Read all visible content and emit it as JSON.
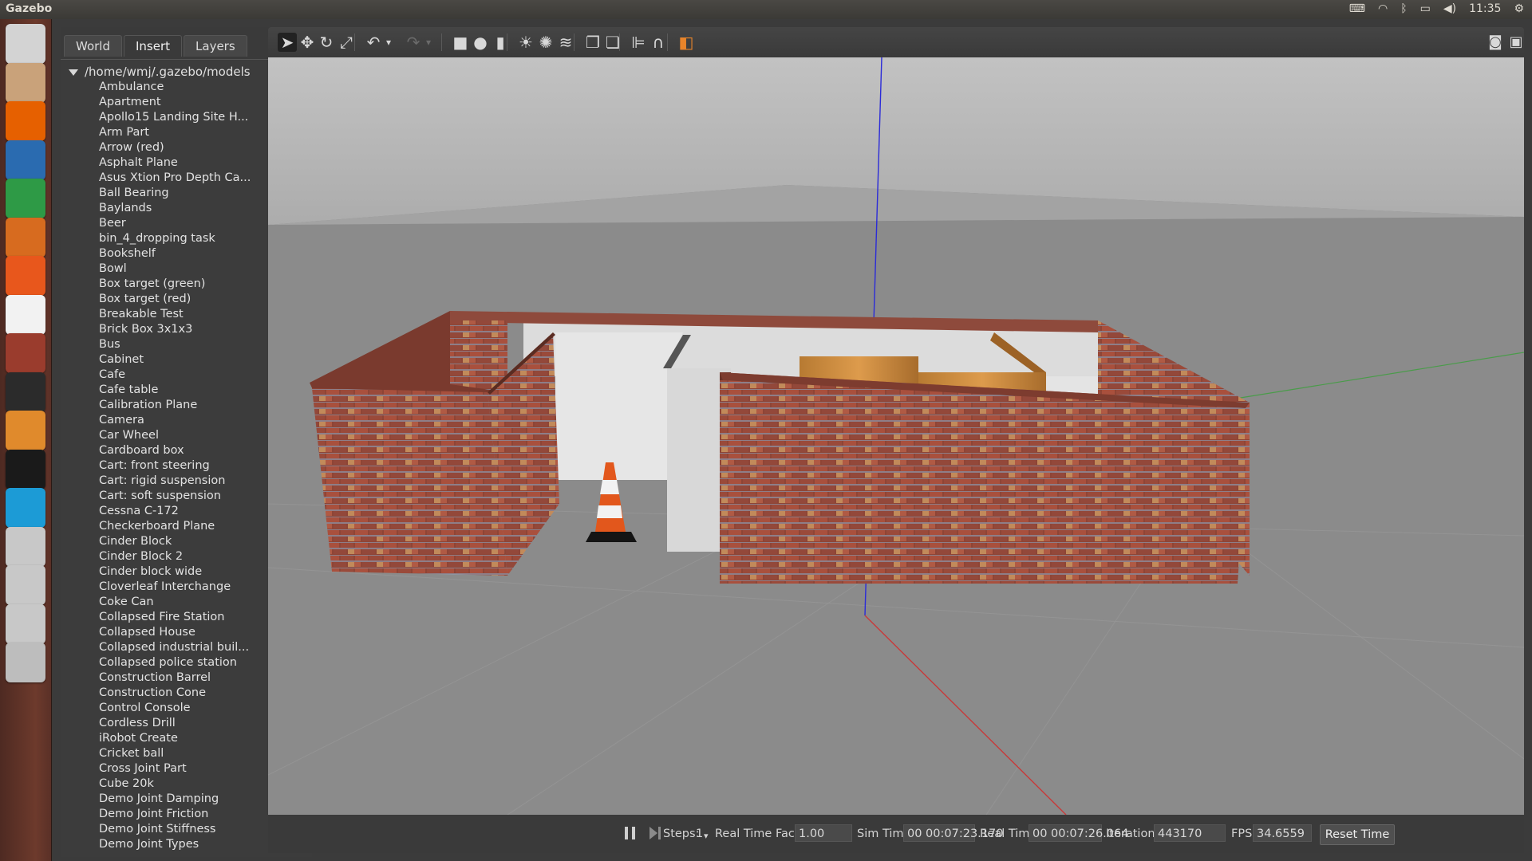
{
  "topbar": {
    "app_title": "Gazebo",
    "clock": "11:35",
    "icons": [
      "keyboard-icon",
      "wifi-icon",
      "bluetooth-icon",
      "battery-icon",
      "volume-icon",
      "settings-icon"
    ]
  },
  "launcher": {
    "items": [
      {
        "name": "ubuntu-dash-icon",
        "color": "#d3d3d3"
      },
      {
        "name": "files-icon",
        "color": "#c9a27a"
      },
      {
        "name": "firefox-icon",
        "color": "#e66000"
      },
      {
        "name": "writer-icon",
        "color": "#2a6bb0"
      },
      {
        "name": "calc-icon",
        "color": "#2e9a46"
      },
      {
        "name": "impress-icon",
        "color": "#d76b1f"
      },
      {
        "name": "software-center-icon",
        "color": "#e8571c"
      },
      {
        "name": "amazon-icon",
        "color": "#f2f2f2"
      },
      {
        "name": "system-settings-icon",
        "color": "#9a3c2d"
      },
      {
        "name": "terminal-icon",
        "color": "#2b2b2b"
      },
      {
        "name": "gazebo-icon",
        "color": "#e08a2c"
      },
      {
        "name": "qq-icon",
        "color": "#1a1a1a"
      },
      {
        "name": "media-player-icon",
        "color": "#1c9bd6"
      },
      {
        "name": "drive-icon-1",
        "color": "#c8c8c8"
      },
      {
        "name": "drive-icon-2",
        "color": "#c8c8c8"
      },
      {
        "name": "drive-icon-3",
        "color": "#c8c8c8"
      },
      {
        "name": "trash-icon",
        "color": "#bdbdbd"
      }
    ]
  },
  "left_panel": {
    "tabs": [
      {
        "label": "World",
        "active": false
      },
      {
        "label": "Insert",
        "active": true
      },
      {
        "label": "Layers",
        "active": false
      }
    ],
    "tree_root": "/home/wmj/.gazebo/models",
    "models": [
      "Ambulance",
      "Apartment",
      "Apollo15 Landing Site H...",
      "Arm Part",
      "Arrow (red)",
      "Asphalt Plane",
      "Asus Xtion Pro Depth Ca...",
      "Ball Bearing",
      "Baylands",
      "Beer",
      "bin_4_dropping task",
      "Bookshelf",
      "Bowl",
      "Box target (green)",
      "Box target (red)",
      "Breakable Test",
      "Brick Box 3x1x3",
      "Bus",
      "Cabinet",
      "Cafe",
      "Cafe table",
      "Calibration Plane",
      "Camera",
      "Car Wheel",
      "Cardboard box",
      "Cart: front steering",
      "Cart: rigid suspension",
      "Cart: soft suspension",
      "Cessna C-172",
      "Checkerboard Plane",
      "Cinder Block",
      "Cinder Block 2",
      "Cinder block wide",
      "Cloverleaf Interchange",
      "Coke Can",
      "Collapsed Fire Station",
      "Collapsed House",
      "Collapsed industrial buil...",
      "Collapsed police station",
      "Construction Barrel",
      "Construction Cone",
      "Control Console",
      "Cordless Drill",
      "iRobot Create",
      "Cricket ball",
      "Cross Joint Part",
      "Cube 20k",
      "Demo Joint Damping",
      "Demo Joint Friction",
      "Demo Joint Stiffness",
      "Demo Joint Types"
    ]
  },
  "toolbar": {
    "tools": [
      {
        "name": "select-tool-icon",
        "glyph": "➤",
        "selected": true
      },
      {
        "name": "translate-tool-icon",
        "glyph": "✥",
        "selected": false
      },
      {
        "name": "rotate-tool-icon",
        "glyph": "↻",
        "selected": false
      },
      {
        "name": "scale-tool-icon",
        "glyph": "⤢",
        "selected": false
      },
      {
        "name": "undo-icon",
        "glyph": "↶",
        "selected": false
      },
      {
        "name": "undo-history-icon",
        "glyph": "▾",
        "selected": false
      },
      {
        "name": "redo-icon",
        "glyph": "↷",
        "selected": false
      },
      {
        "name": "redo-history-icon",
        "glyph": "▾",
        "selected": false
      },
      {
        "name": "box-shape-icon",
        "glyph": "■",
        "selected": false
      },
      {
        "name": "sphere-shape-icon",
        "glyph": "●",
        "selected": false
      },
      {
        "name": "cylinder-shape-icon",
        "glyph": "▮",
        "selected": false
      },
      {
        "name": "point-light-icon",
        "glyph": "☀",
        "selected": false
      },
      {
        "name": "spot-light-icon",
        "glyph": "✺",
        "selected": false
      },
      {
        "name": "directional-light-icon",
        "glyph": "≋",
        "selected": false
      },
      {
        "name": "copy-icon",
        "glyph": "❐",
        "selected": false
      },
      {
        "name": "paste-icon",
        "glyph": "❏",
        "selected": false
      },
      {
        "name": "align-icon",
        "glyph": "⊫",
        "selected": false
      },
      {
        "name": "snap-icon",
        "glyph": "∩",
        "selected": false
      },
      {
        "name": "view-angle-icon",
        "glyph": "◧",
        "selected": false
      }
    ],
    "right_tools": [
      {
        "name": "screenshot-icon",
        "glyph": "◙"
      },
      {
        "name": "record-icon",
        "glyph": "▣"
      }
    ]
  },
  "bottombar": {
    "steps_label": "Steps:",
    "steps_value": "1",
    "rtf_label": "Real Time Factor:",
    "rtf_value": "1.00",
    "sim_time_label": "Sim Time:",
    "sim_time_value": "00 00:07:23.170",
    "real_time_label": "Real Time:",
    "real_time_value": "00 00:07:26.064",
    "iterations_label": "Iterations:",
    "iterations_value": "443170",
    "fps_label": "FPS:",
    "fps_value": "34.6559",
    "reset_label": "Reset Time"
  },
  "scene": {
    "objects": [
      "brick-wall-enclosure",
      "white-inner-walls",
      "wooden-box",
      "traffic-cone",
      "ground-plane-grid",
      "axis-z-line",
      "axis-x-line",
      "axis-y-line"
    ],
    "colors": {
      "sky": "#b9b9b9",
      "ground": "#8a8a8a",
      "brick": "#9a4a3a",
      "inner_wall": "#e2e2e2",
      "wood": "#d28a3a",
      "cone": "#e2571c"
    }
  }
}
